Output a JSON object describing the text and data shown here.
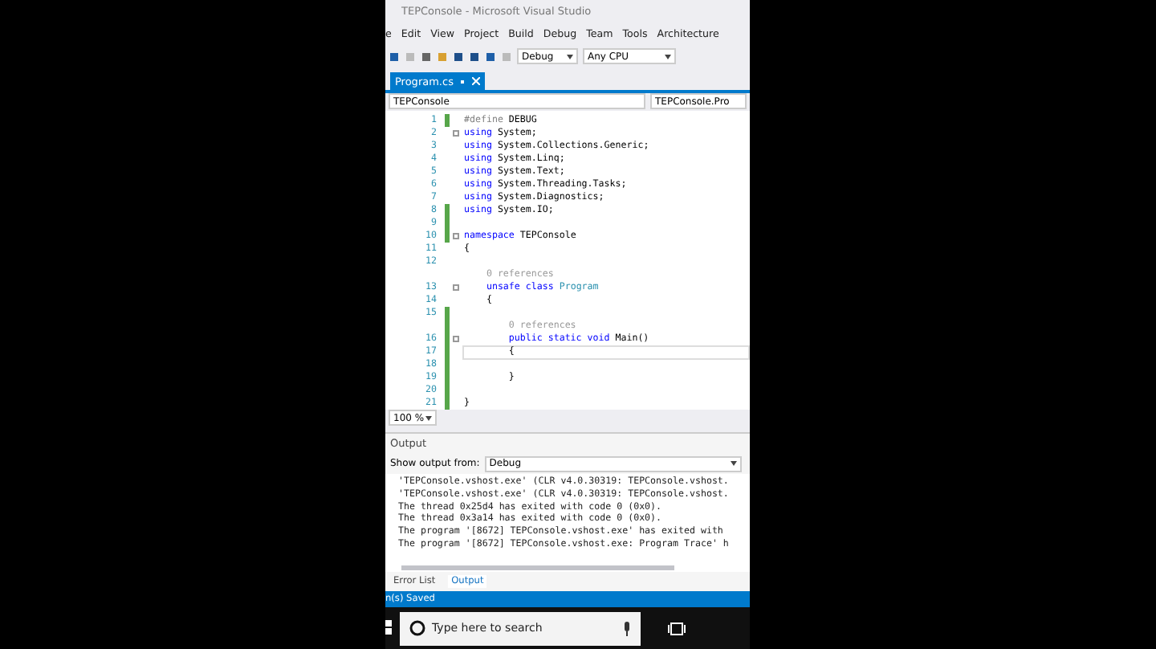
{
  "window": {
    "title": "TEPConsole - Microsoft Visual Studio"
  },
  "menu": [
    "e",
    "Edit",
    "View",
    "Project",
    "Build",
    "Debug",
    "Team",
    "Tools",
    "Architecture"
  ],
  "toolbar": {
    "configuration": "Debug",
    "platform": "Any CPU"
  },
  "tabs": [
    {
      "label": "Program.cs",
      "selected": true
    }
  ],
  "navigation": {
    "project": "TEPConsole",
    "type": "TEPConsole.Pro"
  },
  "editor": {
    "lines": [
      {
        "number": "1",
        "changed": true,
        "fold": false,
        "current": false,
        "tokens": [
          {
            "text": "#define ",
            "kind": "preproc"
          },
          {
            "text": "DEBUG",
            "kind": "plain"
          }
        ]
      },
      {
        "number": "2",
        "changed": false,
        "fold": true,
        "current": false,
        "tokens": [
          {
            "text": "using ",
            "kind": "keyword"
          },
          {
            "text": "System;",
            "kind": "plain"
          }
        ]
      },
      {
        "number": "3",
        "changed": false,
        "fold": false,
        "current": false,
        "tokens": [
          {
            "text": "using ",
            "kind": "keyword"
          },
          {
            "text": "System.Collections.Generic;",
            "kind": "plain"
          }
        ]
      },
      {
        "number": "4",
        "changed": false,
        "fold": false,
        "current": false,
        "tokens": [
          {
            "text": "using ",
            "kind": "keyword"
          },
          {
            "text": "System.Linq;",
            "kind": "plain"
          }
        ]
      },
      {
        "number": "5",
        "changed": false,
        "fold": false,
        "current": false,
        "tokens": [
          {
            "text": "using ",
            "kind": "keyword"
          },
          {
            "text": "System.Text;",
            "kind": "plain"
          }
        ]
      },
      {
        "number": "6",
        "changed": false,
        "fold": false,
        "current": false,
        "tokens": [
          {
            "text": "using ",
            "kind": "keyword"
          },
          {
            "text": "System.Threading.Tasks;",
            "kind": "plain"
          }
        ]
      },
      {
        "number": "7",
        "changed": false,
        "fold": false,
        "current": false,
        "tokens": [
          {
            "text": "using ",
            "kind": "keyword"
          },
          {
            "text": "System.Diagnostics;",
            "kind": "plain"
          }
        ]
      },
      {
        "number": "8",
        "changed": true,
        "fold": false,
        "current": false,
        "tokens": [
          {
            "text": "using ",
            "kind": "keyword"
          },
          {
            "text": "System.IO;",
            "kind": "plain"
          }
        ]
      },
      {
        "number": "9",
        "changed": true,
        "fold": false,
        "current": false
      },
      {
        "number": "10",
        "changed": true,
        "fold": true,
        "current": false,
        "tokens": [
          {
            "text": "namespace ",
            "kind": "keyword"
          },
          {
            "text": "TEPConsole",
            "kind": "plain"
          }
        ]
      },
      {
        "number": "11",
        "changed": false,
        "fold": false,
        "current": false,
        "tokens": [
          {
            "text": "{",
            "kind": "plain"
          }
        ]
      },
      {
        "number": "12",
        "changed": false,
        "fold": false,
        "current": false
      },
      {
        "number": "13",
        "changed": false,
        "fold": true,
        "current": false,
        "lens": "    0 references",
        "tokens": [
          {
            "text": "    unsafe class ",
            "kind": "keyword"
          },
          {
            "text": "Program",
            "kind": "type"
          }
        ]
      },
      {
        "number": "14",
        "changed": false,
        "fold": false,
        "current": false,
        "tokens": [
          {
            "text": "    {",
            "kind": "plain"
          }
        ]
      },
      {
        "number": "15",
        "changed": true,
        "fold": false,
        "current": false
      },
      {
        "number": "16",
        "changed": true,
        "fold": true,
        "current": false,
        "lens": "        0 references",
        "tokens": [
          {
            "text": "        public static void ",
            "kind": "keyword"
          },
          {
            "text": "Main()",
            "kind": "plain"
          }
        ]
      },
      {
        "number": "17",
        "changed": true,
        "fold": false,
        "current": true,
        "tokens": [
          {
            "text": "        {",
            "kind": "plain"
          }
        ]
      },
      {
        "number": "18",
        "changed": true,
        "fold": false,
        "current": false
      },
      {
        "number": "19",
        "changed": true,
        "fold": false,
        "current": false,
        "tokens": [
          {
            "text": "        }",
            "kind": "plain"
          }
        ]
      },
      {
        "number": "20",
        "changed": true,
        "fold": false,
        "current": false
      },
      {
        "number": "21",
        "changed": true,
        "fold": false,
        "current": false,
        "tokens": [
          {
            "text": "}",
            "kind": "plain"
          }
        ]
      }
    ]
  },
  "zoom": "100 %",
  "output": {
    "title": "Output",
    "source_label": "Show output from:",
    "source": "Debug",
    "lines": [
      "'TEPConsole.vshost.exe' (CLR v4.0.30319: TEPConsole.vshost.",
      "'TEPConsole.vshost.exe' (CLR v4.0.30319: TEPConsole.vshost.",
      "The thread 0x25d4 has exited with code 0 (0x0).",
      "The thread 0x3a14 has exited with code 0 (0x0).",
      "The program '[8672] TEPConsole.vshost.exe' has exited with",
      "The program '[8672] TEPConsole.vshost.exe: Program Trace' h"
    ]
  },
  "panel_tabs": [
    {
      "label": "Error List",
      "selected": false
    },
    {
      "label": "Output",
      "selected": true
    }
  ],
  "status_bar": "n(s) Saved",
  "taskbar": {
    "search_placeholder": "Type here to search"
  }
}
